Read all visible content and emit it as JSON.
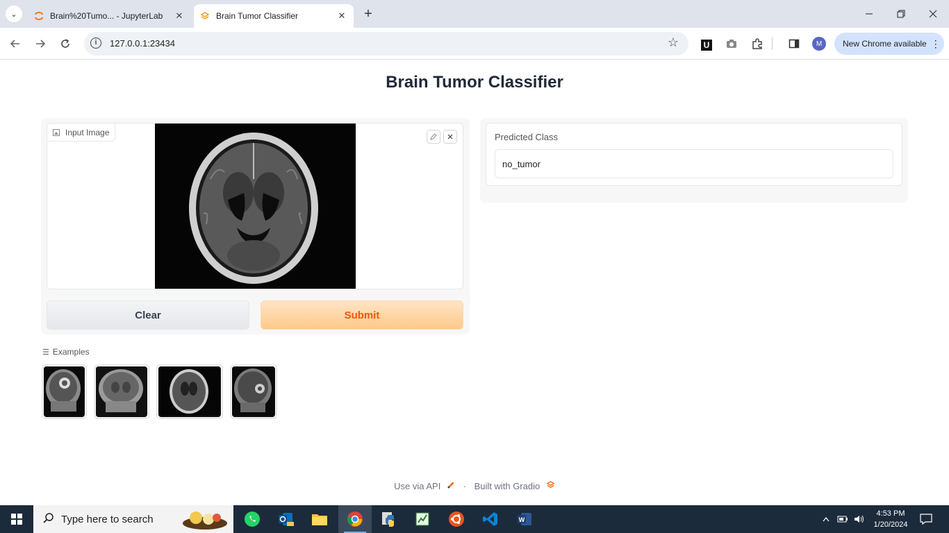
{
  "browser": {
    "tabs": [
      {
        "title": "Brain%20Tumo... - JupyterLab",
        "active": false
      },
      {
        "title": "Brain Tumor Classifier",
        "active": true
      }
    ],
    "url": "127.0.0.1:23434",
    "profile_initial": "M",
    "extension_label": "U",
    "new_chrome_label": "New Chrome available"
  },
  "page": {
    "title": "Brain Tumor Classifier",
    "input_label": "Input Image",
    "clear_label": "Clear",
    "submit_label": "Submit",
    "examples_label": "Examples",
    "output_label": "Predicted Class",
    "output_value": "no_tumor",
    "footer_api": "Use via API",
    "footer_sep": "·",
    "footer_built": "Built with Gradio"
  },
  "taskbar": {
    "search_placeholder": "Type here to search",
    "time": "4:53 PM",
    "date": "1/20/2024"
  },
  "colors": {
    "accent_orange": "#ea580c",
    "submit_bg": "#fdc98a",
    "taskbar_bg": "#1c2b3b"
  }
}
